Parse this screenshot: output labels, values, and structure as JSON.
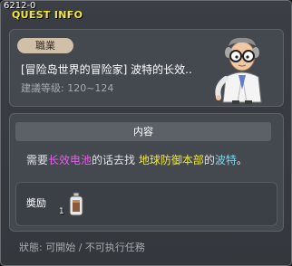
{
  "quest_id": "6212-0",
  "window_title": "QUEST INFO",
  "header": {
    "job_badge": "職業",
    "quest_name": "[冒险岛世界的冒险家] 波特的长效..",
    "required_level": "建議等级: 120~124",
    "npc_icon": "npc-scientist-icon"
  },
  "content": {
    "header": "内容",
    "text_prefix": "需要",
    "item": "长效电池",
    "text_middle": "的话去找 ",
    "place": "地球防御本部",
    "text_of": "的",
    "npc": "波特",
    "text_suffix": "。",
    "colors": {
      "item": "#e65ee6",
      "place": "#f2e83a",
      "npc": "#7ad8f0"
    }
  },
  "reward": {
    "label": "奬励",
    "item_icon": "battery-item-icon",
    "count": "1"
  },
  "status": "狀態: 可開始 / 不可执行任務"
}
